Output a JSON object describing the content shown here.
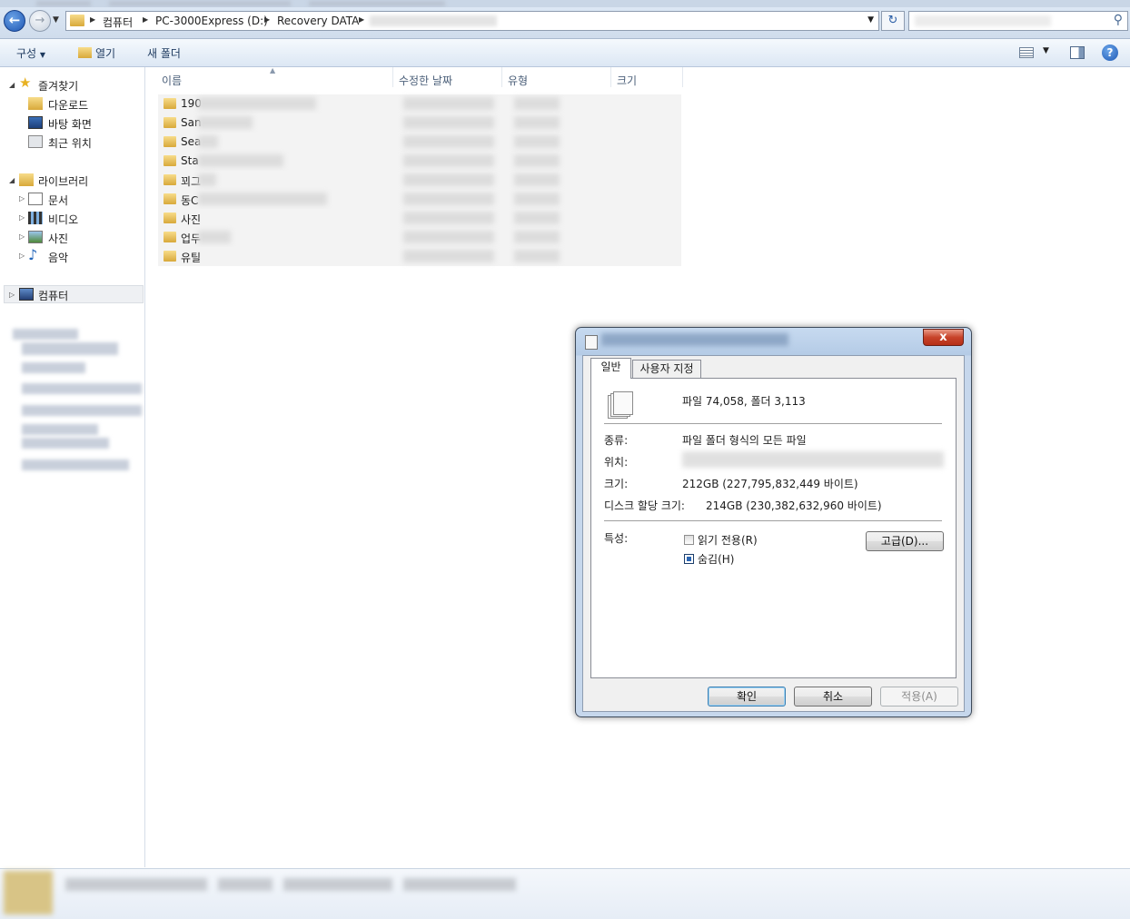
{
  "address_bar": {
    "crumbs": [
      "컴퓨터",
      "PC-3000Express (D:)",
      "Recovery DATA"
    ]
  },
  "toolbar": {
    "organize": "구성",
    "open": "열기",
    "new_folder": "새 폴더"
  },
  "navigation": {
    "favorites": "즐겨찾기",
    "downloads": "다운로드",
    "desktop": "바탕 화면",
    "recent": "최근 위치",
    "libraries": "라이브러리",
    "documents": "문서",
    "videos": "비디오",
    "pictures": "사진",
    "music": "음악",
    "computer": "컴퓨터"
  },
  "file_list": {
    "columns": [
      "이름",
      "수정한 날짜",
      "유형",
      "크기"
    ],
    "rows": [
      "190",
      "San",
      "Sea",
      "Sta",
      "꾀그",
      "동C",
      "사진",
      "업두",
      "유틸"
    ]
  },
  "properties_dialog": {
    "tabs": [
      "일반",
      "사용자 지정"
    ],
    "summary": "파일 74,058, 폴더 3,113",
    "type_label": "종류:",
    "type_value": "파일 폴더 형식의 모든 파일",
    "location_label": "위치:",
    "size_label": "크기:",
    "size_value": "212GB (227,795,832,449 바이트)",
    "disk_label": "디스크 할당 크기:",
    "disk_value": "214GB (230,382,632,960 바이트)",
    "attributes_label": "특성:",
    "readonly_label": "읽기 전용(R)",
    "readonly_checked": false,
    "hidden_label": "숨김(H)",
    "hidden_checked": true,
    "advanced_button": "고급(D)...",
    "ok_button": "확인",
    "cancel_button": "취소",
    "apply_button": "적용(A)",
    "close_glyph": "x"
  }
}
